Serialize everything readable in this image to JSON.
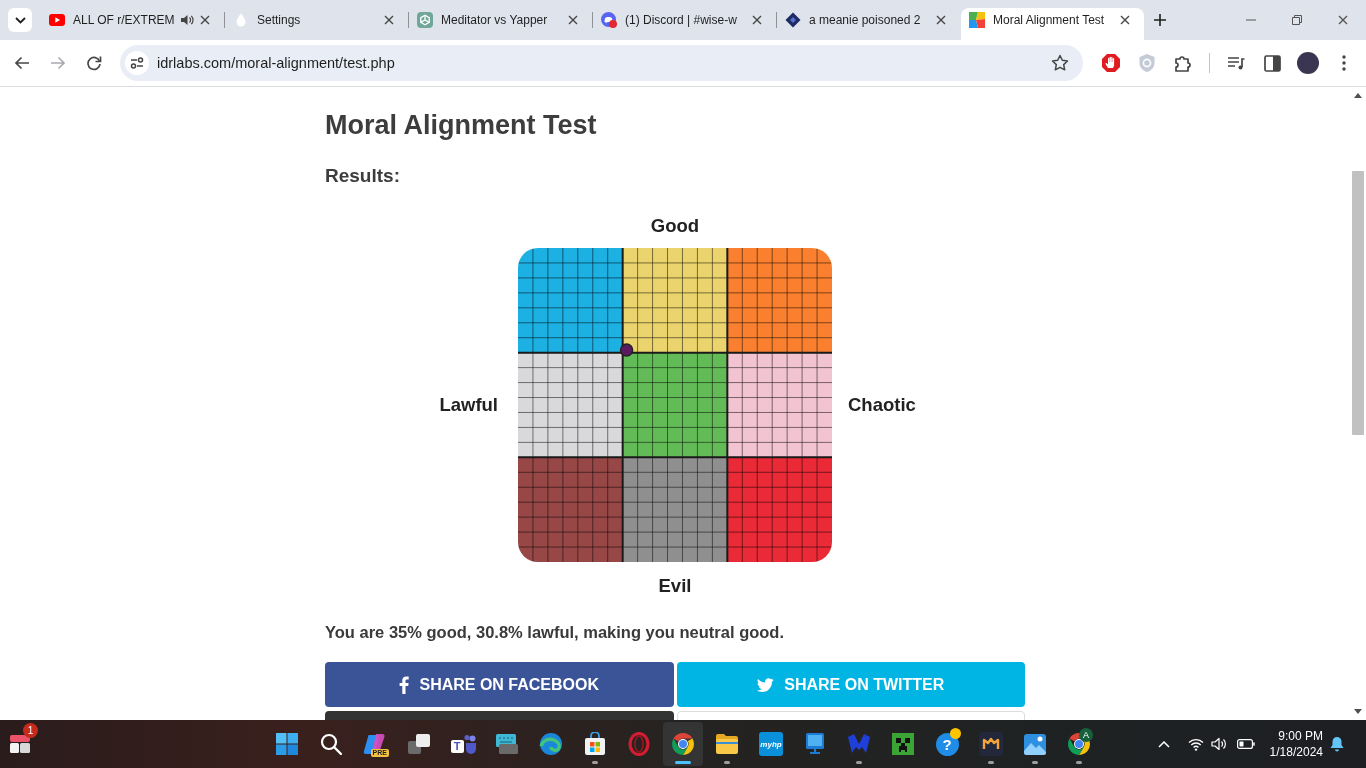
{
  "browser": {
    "tabs": [
      {
        "kind": "video",
        "title": "ALL OF r/EXTREM",
        "audio": true,
        "selected": false
      },
      {
        "kind": "drop",
        "title": "Settings",
        "audio": false,
        "selected": false
      },
      {
        "kind": "knot",
        "title": "Meditator vs Yapper",
        "audio": false,
        "selected": false
      },
      {
        "kind": "round",
        "title": "(1) Discord | #wise-w",
        "audio": false,
        "selected": false
      },
      {
        "kind": "diamond",
        "title": "a meanie poisoned 2",
        "audio": false,
        "selected": false
      },
      {
        "kind": "squares",
        "title": "Moral Alignment Test",
        "audio": false,
        "selected": true
      }
    ],
    "nav_buttons": [
      {
        "kind": "back",
        "disabled": false
      },
      {
        "kind": "forward",
        "disabled": true
      },
      {
        "kind": "reload",
        "disabled": false
      }
    ],
    "address_bar": {
      "url": "idrlabs.com/moral-alignment/test.php",
      "bookmarked": false
    }
  },
  "page": {
    "title": "Moral Alignment Test",
    "results_label": "Results:",
    "alignment_chart": {
      "axis_labels": {
        "top": "Good",
        "left": "Lawful",
        "right": "Chaotic",
        "bottom": "Evil"
      },
      "regions": [
        {
          "color": "#1cb0e3"
        },
        {
          "color": "#ebd46d"
        },
        {
          "color": "#fa802f"
        },
        {
          "color": "#d9d9db"
        },
        {
          "color": "#62bb57"
        },
        {
          "color": "#f2c3d0"
        },
        {
          "color": "#984747"
        },
        {
          "color": "#8f8f90"
        },
        {
          "color": "#ea2a37"
        }
      ]
    },
    "summary": "You are 35% good, 30.8% lawful, making you neutral good.",
    "share_buttons": [
      {
        "kind": "facebook",
        "label": "SHARE ON FACEBOOK"
      },
      {
        "kind": "twitter",
        "label": "SHARE ON TWITTER"
      },
      {
        "kind": "dark"
      },
      {
        "kind": "light"
      }
    ]
  },
  "taskbar": {
    "widgets": {
      "badge": "1"
    },
    "apps": [
      {
        "kind": "start",
        "running": false,
        "selected": false
      },
      {
        "kind": "search",
        "running": false,
        "selected": false
      },
      {
        "kind": "swirl",
        "badge": "PRE",
        "running": false,
        "selected": false
      },
      {
        "kind": "taskview",
        "running": false,
        "selected": false
      },
      {
        "kind": "people",
        "letter": "T",
        "running": false,
        "selected": false
      },
      {
        "kind": "keyboard",
        "running": false,
        "selected": false
      },
      {
        "kind": "wave",
        "running": false,
        "selected": false
      },
      {
        "kind": "store",
        "running": true,
        "selected": false
      },
      {
        "kind": "ring",
        "running": false,
        "selected": false
      },
      {
        "kind": "browser",
        "running": true,
        "selected": true
      },
      {
        "kind": "folder",
        "running": true,
        "selected": false
      },
      {
        "kind": "wordmark",
        "letter": "myhp",
        "running": false,
        "selected": false
      },
      {
        "kind": "device",
        "running": false,
        "selected": false
      },
      {
        "kind": "wing",
        "running": true,
        "selected": false
      },
      {
        "kind": "creeper",
        "running": false,
        "selected": false
      },
      {
        "kind": "help",
        "letter": "?",
        "running": false,
        "selected": false
      },
      {
        "kind": "emblem",
        "running": true,
        "selected": false
      },
      {
        "kind": "photos",
        "running": true,
        "selected": false
      },
      {
        "kind": "browser",
        "badge": "A",
        "running": true,
        "selected": false
      }
    ],
    "clock": {
      "time": "9:00 PM",
      "date": "1/18/2024"
    }
  }
}
